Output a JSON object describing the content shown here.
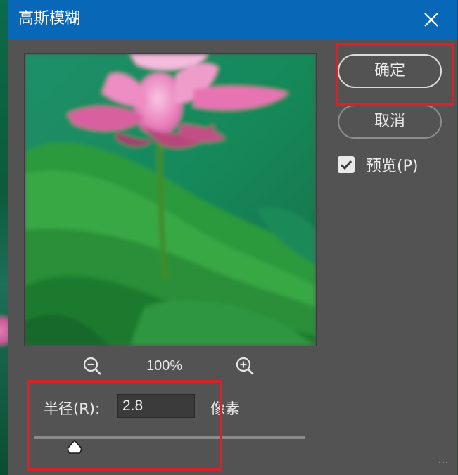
{
  "dialog": {
    "title": "高斯模糊",
    "close_icon": "close-icon"
  },
  "preview": {
    "image": "pink lotus flower with green leaves",
    "zoom_level": "100%",
    "zoom_out_icon": "zoom-out-icon",
    "zoom_in_icon": "zoom-in-icon"
  },
  "radius": {
    "label": "半径(R):",
    "value": "2.8",
    "unit": "像素",
    "slider_value": 2.8,
    "slider_fraction": 0.15
  },
  "buttons": {
    "ok_label": "确定",
    "cancel_label": "取消"
  },
  "preview_option": {
    "label": "预览(P)",
    "checked": true
  },
  "colors": {
    "titlebar": "#0867b6",
    "dialog_bg": "#535353",
    "highlight": "#d8222a"
  }
}
